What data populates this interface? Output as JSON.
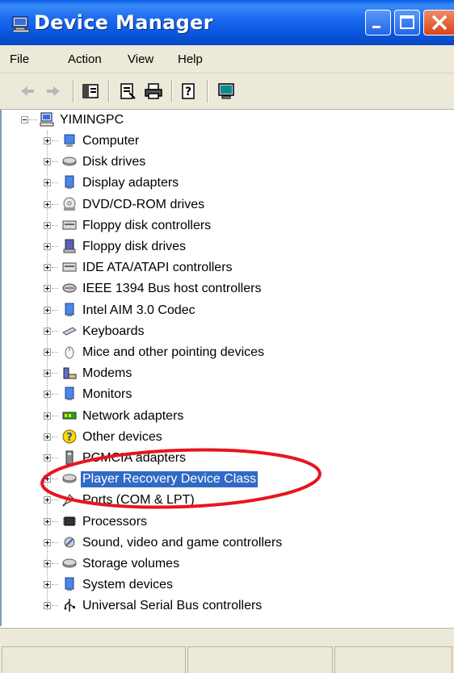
{
  "window": {
    "title": "Device Manager"
  },
  "menu": [
    "File",
    "Action",
    "View",
    "Help"
  ],
  "tree": {
    "root": "YIMINGPC",
    "items": [
      {
        "label": "Computer",
        "icon": "computer-icon"
      },
      {
        "label": "Disk drives",
        "icon": "disk-drive-icon"
      },
      {
        "label": "Display adapters",
        "icon": "display-adapter-icon"
      },
      {
        "label": "DVD/CD-ROM drives",
        "icon": "cdrom-icon"
      },
      {
        "label": "Floppy disk controllers",
        "icon": "controller-icon"
      },
      {
        "label": "Floppy disk drives",
        "icon": "floppy-icon"
      },
      {
        "label": "IDE ATA/ATAPI controllers",
        "icon": "controller-icon"
      },
      {
        "label": "IEEE 1394 Bus host controllers",
        "icon": "firewire-icon"
      },
      {
        "label": "Intel AIM 3.0 Codec",
        "icon": "codec-icon"
      },
      {
        "label": "Keyboards",
        "icon": "keyboard-icon"
      },
      {
        "label": "Mice and other pointing devices",
        "icon": "mouse-icon"
      },
      {
        "label": "Modems",
        "icon": "modem-icon"
      },
      {
        "label": "Monitors",
        "icon": "monitor-icon"
      },
      {
        "label": "Network adapters",
        "icon": "network-adapter-icon"
      },
      {
        "label": "Other devices",
        "icon": "unknown-device-icon"
      },
      {
        "label": "PCMCIA adapters",
        "icon": "pcmcia-icon"
      },
      {
        "label": "Player Recovery Device Class",
        "icon": "disk-drive-icon",
        "selected": true
      },
      {
        "label": "Ports (COM & LPT)",
        "icon": "port-icon"
      },
      {
        "label": "Processors",
        "icon": "processor-icon"
      },
      {
        "label": "Sound, video and game controllers",
        "icon": "sound-icon"
      },
      {
        "label": "Storage volumes",
        "icon": "storage-volume-icon"
      },
      {
        "label": "System devices",
        "icon": "system-device-icon"
      },
      {
        "label": "Universal Serial Bus controllers",
        "icon": "usb-icon"
      }
    ]
  },
  "colors": {
    "selection": "#316ac5",
    "annotation": "#e8141e",
    "titlebar": "#0a5ce6"
  }
}
